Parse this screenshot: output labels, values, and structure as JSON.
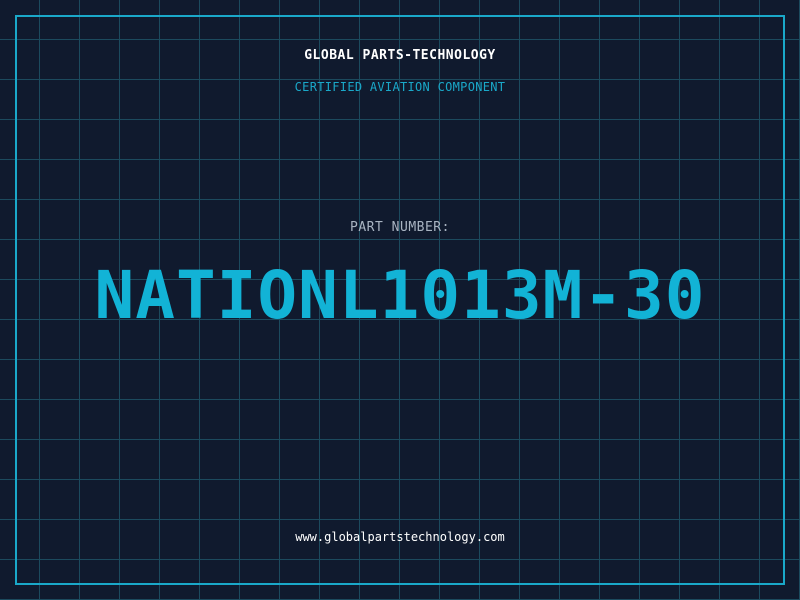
{
  "header": {
    "company": "GLOBAL PARTS-TECHNOLOGY",
    "tagline": "CERTIFIED AVIATION COMPONENT"
  },
  "part": {
    "label": "PART NUMBER:",
    "number": "NATIONL1013M-30"
  },
  "footer": {
    "website": "www.globalpartstechnology.com"
  },
  "colors": {
    "background": "#101a2e",
    "grid": "#1c4a5e",
    "accent": "#12b3d6",
    "label": "#a9b4c2",
    "text": "#ffffff"
  }
}
